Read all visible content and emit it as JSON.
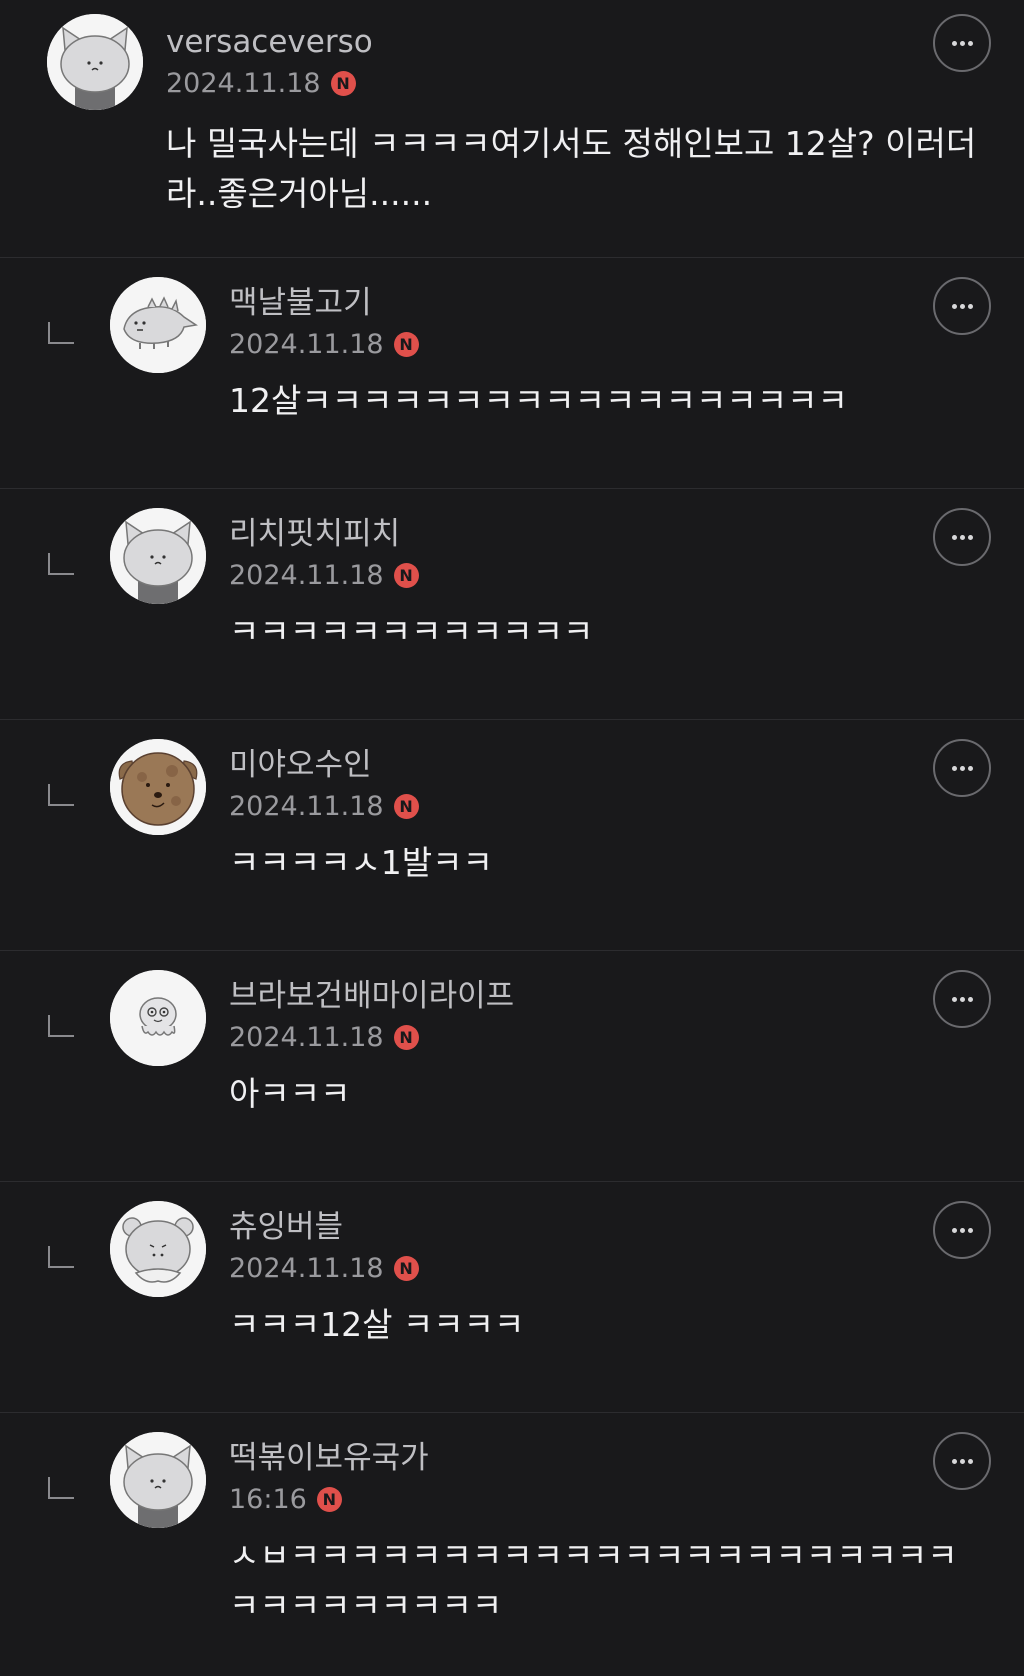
{
  "comments": [
    {
      "nickname": "versaceverso",
      "date": "2024.11.18",
      "badge": "N",
      "text": "나 밀국사는데 ㅋㅋㅋㅋ여기서도 정해인보고 12살? 이러더라..좋은거아님......",
      "avatar": "cat-gray-avatar",
      "more_icon": "more-dots-icon"
    },
    {
      "nickname": "맥날불고기",
      "date": "2024.11.18",
      "badge": "N",
      "text": "12살ㅋㅋㅋㅋㅋㅋㅋㅋㅋㅋㅋㅋㅋㅋㅋㅋㅋㅋ",
      "avatar": "dino-avatar",
      "more_icon": "more-dots-icon"
    },
    {
      "nickname": "리치핏치피치",
      "date": "2024.11.18",
      "badge": "N",
      "text": "ㅋㅋㅋㅋㅋㅋㅋㅋㅋㅋㅋㅋ",
      "avatar": "cat-gray-avatar",
      "more_icon": "more-dots-icon"
    },
    {
      "nickname": "미야오수인",
      "date": "2024.11.18",
      "badge": "N",
      "text": "ㅋㅋㅋㅋㅅ1발ㅋㅋ",
      "avatar": "brown-dog-avatar",
      "more_icon": "more-dots-icon"
    },
    {
      "nickname": "브라보건배마이라이프",
      "date": "2024.11.18",
      "badge": "N",
      "text": "아ㅋㅋㅋ",
      "avatar": "octopus-avatar",
      "more_icon": "more-dots-icon"
    },
    {
      "nickname": "츄잉버블",
      "date": "2024.11.18",
      "badge": "N",
      "text": "ㅋㅋㅋ12살 ㅋㅋㅋㅋ",
      "avatar": "bear-avatar",
      "more_icon": "more-dots-icon"
    },
    {
      "nickname": "떡볶이보유국가",
      "date": "16:16",
      "badge": "N",
      "text": "ㅅㅂㅋㅋㅋㅋㅋㅋㅋㅋㅋㅋㅋㅋㅋㅋㅋㅋㅋㅋㅋㅋㅋㅋㅋㅋㅋㅋㅋㅋㅋㅋㅋ",
      "avatar": "cat-gray-avatar",
      "more_icon": "more-dots-icon"
    }
  ],
  "colors": {
    "background": "#19191b",
    "divider": "#2c2c2f",
    "badge": "#e0504b",
    "nickname": "#bfbfc3",
    "date": "#9a9a9e",
    "text": "#f0f0f2"
  }
}
